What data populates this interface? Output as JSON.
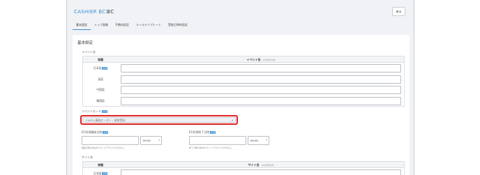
{
  "breadcrumb": {
    "root": "CASHIER EC1",
    "separator": "〉",
    "current": "EC"
  },
  "back_button": "戻る",
  "tabs": [
    {
      "label": "基本設定",
      "active": true
    },
    {
      "label": "トップ画像",
      "active": false
    },
    {
      "label": "手数料設定",
      "active": false
    },
    {
      "label": "メールテンプレート",
      "active": false
    },
    {
      "label": "受取日時枠設定",
      "active": false
    }
  ],
  "panel_title": "基本設定",
  "event_name": {
    "label": "イベント名",
    "header_lang": "言語",
    "header_name": "イベント名",
    "header_note": "128文字以内",
    "rows": [
      {
        "lang": "日本語",
        "required": "必須"
      },
      {
        "lang": "英語",
        "required": ""
      },
      {
        "lang": "中国語",
        "required": ""
      },
      {
        "lang": "韓国語",
        "required": ""
      }
    ]
  },
  "event_mode": {
    "label": "イベントモード",
    "required": "必須",
    "selected": "CASE1(事前オーダー・現地受取)"
  },
  "ec_start": {
    "label": "EC利用開始日時",
    "required": "必須",
    "time": "00:00",
    "hint": "開始日時以前はECサイトアクセスできません。"
  },
  "ec_end": {
    "label": "EC利用終了日時",
    "required": "必須",
    "time": "00:00",
    "hint": "終了日時以降はECサイトアクセスできません。"
  },
  "site_name": {
    "label": "サイト名",
    "header_lang": "言語",
    "header_name": "サイト名",
    "header_note": "128文字以内",
    "first_row_lang": "日本語",
    "first_row_required": "必須"
  },
  "colors": {
    "accent": "#3a8ed6",
    "highlight": "#e02020",
    "background": "#f0f2f5"
  }
}
